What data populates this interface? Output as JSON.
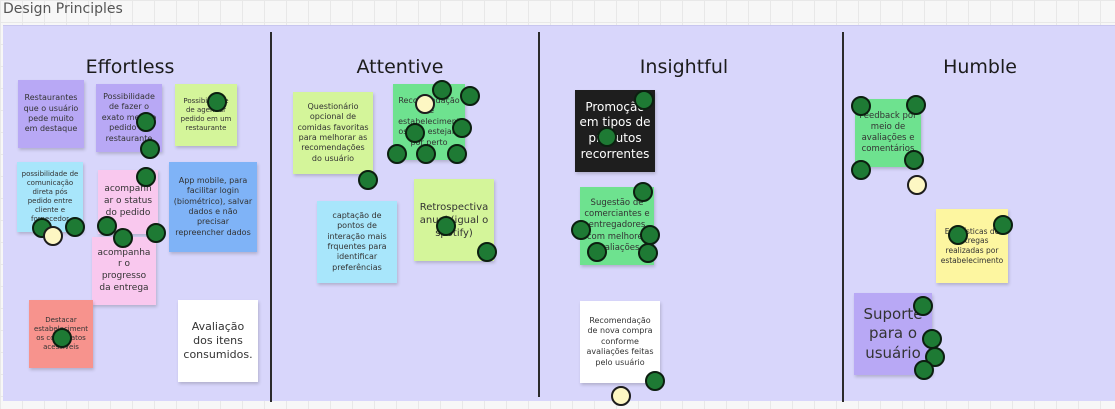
{
  "frame": {
    "title": "Design Principles"
  },
  "columns": [
    {
      "title": "Effortless"
    },
    {
      "title": "Attentive"
    },
    {
      "title": "Insightful"
    },
    {
      "title": "Humble"
    }
  ],
  "colors": {
    "board": "#d8d6fb",
    "purple": "#b8a8f5",
    "lime": "#d4f59a",
    "cyan": "#a8e6fb",
    "pink": "#f9c8ee",
    "blue": "#7fb3f7",
    "red": "#f7938d",
    "white": "#ffffff",
    "green": "#6ee28f",
    "black": "#1e1e1e",
    "yellow": "#fdf6a0",
    "vote_green": "#1e7a34",
    "vote_yellow": "#fdf7c3"
  },
  "notes": [
    {
      "text": "Restaurantes que o usuário pede muito em destaque"
    },
    {
      "text": "Possibilidade de fazer o exato mesmo pedido no restaurante"
    },
    {
      "text": "Possibilidade de agendar pedido em um restaurante"
    },
    {
      "text": "possibilidade de comunicação direta pós pedido entre cliente e fornecedor"
    },
    {
      "text": "acompanhar o status do pedido"
    },
    {
      "text": "App mobile, para facilitar login (biométrico), salvar dados e não precisar repreencher dados"
    },
    {
      "text": "acompanhar o progresso da entrega"
    },
    {
      "text": "Destacar estabelecimentos com pratos acessíveis"
    },
    {
      "text": "Avaliação dos itens consumidos."
    },
    {
      "text": "Questionário opcional de comidas favoritas para melhorar as recomendações do usuário"
    },
    {
      "text": "Recomendação de estabelecimentos que estejam por perto"
    },
    {
      "text": "captação de pontos de interação mais frquentes para identificar preferências"
    },
    {
      "text": "Retrospectiva anual (igual o spotify)"
    },
    {
      "text": "Promoção em tipos de produtos recorrentes"
    },
    {
      "text": "Sugestão de comerciantes e entregadores com melhores avaliações"
    },
    {
      "text": "Recomendação de nova compra conforme avaliações feitas pelo usuário"
    },
    {
      "text": "Feedback por meio de avaliações e comentários"
    },
    {
      "text": "Estatísticas de entregas realizadas por estabelecimento"
    },
    {
      "text": "Suporte para o usuário"
    }
  ]
}
